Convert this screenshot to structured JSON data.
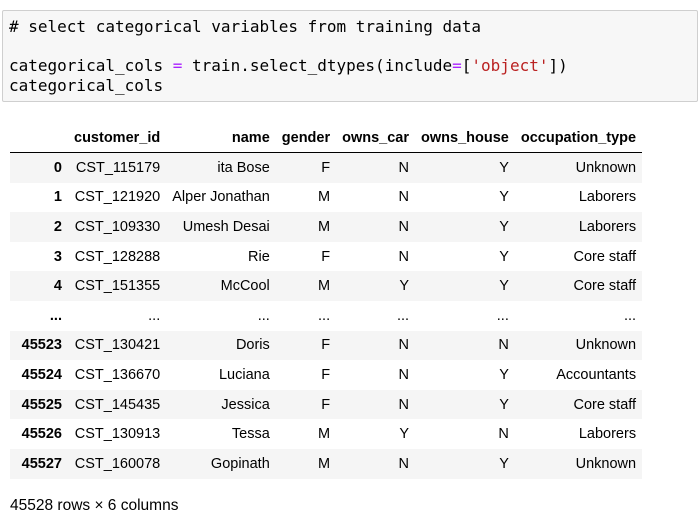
{
  "code_cell": {
    "comment": "# select categorical variables from training data",
    "line2_var": "categorical_cols",
    "line2_eq": " = ",
    "line2_call": "train.select_dtypes(include",
    "line2_eq2": "=",
    "line2_bracket_open": "[",
    "line2_str": "'object'",
    "line2_bracket_close": "])",
    "line3": "categorical_cols"
  },
  "table": {
    "columns": [
      "",
      "customer_id",
      "name",
      "gender",
      "owns_car",
      "owns_house",
      "occupation_type"
    ],
    "rows": [
      [
        "0",
        "CST_115179",
        "ita Bose",
        "F",
        "N",
        "Y",
        "Unknown"
      ],
      [
        "1",
        "CST_121920",
        "Alper Jonathan",
        "M",
        "N",
        "Y",
        "Laborers"
      ],
      [
        "2",
        "CST_109330",
        "Umesh Desai",
        "M",
        "N",
        "Y",
        "Laborers"
      ],
      [
        "3",
        "CST_128288",
        "Rie",
        "F",
        "N",
        "Y",
        "Core staff"
      ],
      [
        "4",
        "CST_151355",
        "McCool",
        "M",
        "Y",
        "Y",
        "Core staff"
      ],
      [
        "...",
        "...",
        "...",
        "...",
        "...",
        "...",
        "..."
      ],
      [
        "45523",
        "CST_130421",
        "Doris",
        "F",
        "N",
        "N",
        "Unknown"
      ],
      [
        "45524",
        "CST_136670",
        "Luciana",
        "F",
        "N",
        "Y",
        "Accountants"
      ],
      [
        "45525",
        "CST_145435",
        "Jessica",
        "F",
        "N",
        "Y",
        "Core staff"
      ],
      [
        "45526",
        "CST_130913",
        "Tessa",
        "M",
        "Y",
        "N",
        "Laborers"
      ],
      [
        "45527",
        "CST_160078",
        "Gopinath",
        "M",
        "N",
        "Y",
        "Unknown"
      ]
    ]
  },
  "footer": "45528 rows × 6 columns",
  "colors": {
    "comment": "#408080",
    "operator": "#aa22ff",
    "string": "#ba2121",
    "cell_bg": "#f7f7f7",
    "cell_border": "#cfcfcf",
    "row_stripe": "#f5f5f5"
  }
}
